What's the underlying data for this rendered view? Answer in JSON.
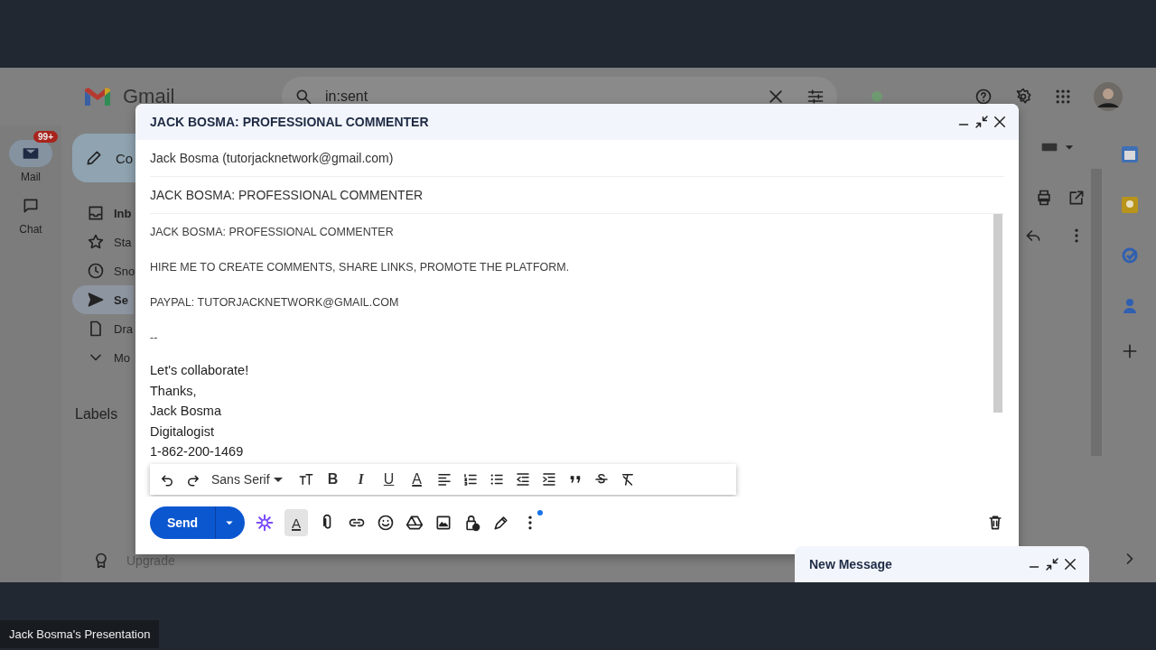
{
  "gmail": {
    "app_name": "Gmail",
    "search": {
      "value": "in:sent"
    },
    "rail": [
      {
        "label": "Mail",
        "kind": "mail",
        "badge": "99+",
        "selected": true
      },
      {
        "label": "Chat",
        "kind": "chat",
        "selected": false
      }
    ],
    "compose_button": {
      "label": "Co"
    },
    "nav": [
      {
        "label": "Inb",
        "kind": "inbox",
        "selected": false
      },
      {
        "label": "Sta",
        "kind": "star",
        "selected": false
      },
      {
        "label": "Sno",
        "kind": "clock",
        "selected": false
      },
      {
        "label": "Se",
        "kind": "send",
        "selected": true
      },
      {
        "label": "Dra",
        "kind": "draft",
        "selected": false
      },
      {
        "label": "Mo",
        "kind": "chevron",
        "selected": false
      }
    ],
    "labels_heading": "Labels",
    "upgrade": {
      "label": "Upgrade"
    }
  },
  "compose": {
    "title": "JACK BOSMA: PROFESSIONAL COMMENTER",
    "from": "Jack Bosma (tutorjacknetwork@gmail.com)",
    "subject": "JACK BOSMA: PROFESSIONAL COMMENTER",
    "body": [
      {
        "kind": "caps",
        "text": "JACK BOSMA: PROFESSIONAL COMMENTER"
      },
      {
        "kind": "caps",
        "text": "HIRE ME TO CREATE COMMENTS, SHARE LINKS, PROMOTE THE PLATFORM."
      },
      {
        "kind": "caps",
        "text": "PAYPAL: TUTORJACKNETWORK@GMAIL.COM"
      },
      {
        "kind": "caps",
        "text": "--"
      },
      {
        "kind": "signature",
        "text": "Let's collaborate!"
      },
      {
        "kind": "line",
        "text": "Thanks,"
      },
      {
        "kind": "line",
        "text": "Jack Bosma"
      },
      {
        "kind": "line",
        "text": "Digitalogist"
      },
      {
        "kind": "line",
        "text": "1-862-200-1469"
      }
    ],
    "format_toolbar": [
      {
        "kind": "undo"
      },
      {
        "kind": "redo"
      },
      {
        "kind": "font",
        "label": "Sans Serif"
      },
      {
        "kind": "size"
      },
      {
        "kind": "bold",
        "glyph": "B"
      },
      {
        "kind": "italic",
        "glyph": "I"
      },
      {
        "kind": "underline",
        "glyph": "U"
      },
      {
        "kind": "color",
        "glyph": "A"
      },
      {
        "kind": "align"
      },
      {
        "kind": "numbered"
      },
      {
        "kind": "bulleted"
      },
      {
        "kind": "outdent"
      },
      {
        "kind": "indent"
      },
      {
        "kind": "quote"
      },
      {
        "kind": "strike"
      },
      {
        "kind": "clear"
      }
    ],
    "send": "Send",
    "actions": [
      {
        "kind": "sparkle",
        "selected": false
      },
      {
        "kind": "format",
        "glyph": "A",
        "selected": true
      },
      {
        "kind": "attach",
        "selected": false
      },
      {
        "kind": "link",
        "selected": false
      },
      {
        "kind": "emoji",
        "selected": false
      },
      {
        "kind": "drive",
        "selected": false
      },
      {
        "kind": "image",
        "selected": false
      },
      {
        "kind": "lock",
        "selected": false
      },
      {
        "kind": "pen",
        "selected": false
      },
      {
        "kind": "more",
        "selected": false
      }
    ]
  },
  "minimized_compose": {
    "title": "New Message"
  },
  "presentation_label": "Jack Bosma's Presentation"
}
